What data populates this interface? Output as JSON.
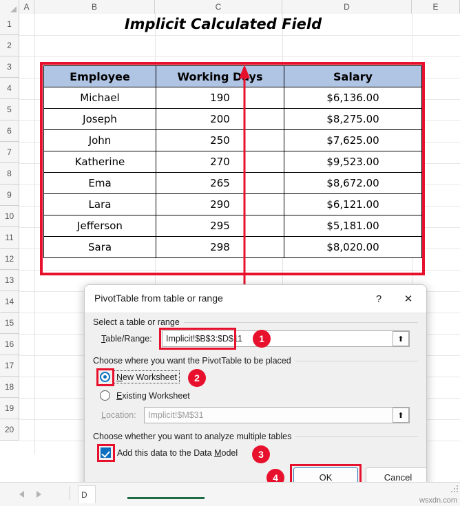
{
  "spreadsheet": {
    "column_headers": [
      "A",
      "B",
      "C",
      "D",
      "E"
    ],
    "row_headers": [
      "1",
      "2",
      "3",
      "4",
      "5",
      "6",
      "7",
      "8",
      "9",
      "10",
      "11",
      "12",
      "13",
      "14",
      "15",
      "16",
      "17",
      "18",
      "19",
      "20"
    ],
    "title": "Implicit Calculated Field",
    "header_fill": "#b0c4e4",
    "annotation_color": "#e8112d"
  },
  "table": {
    "columns": [
      "Employee",
      "Working Days",
      "Salary"
    ],
    "rows": [
      {
        "employee": "Michael",
        "working_days": "190",
        "salary": "$6,136.00"
      },
      {
        "employee": "Joseph",
        "working_days": "200",
        "salary": "$8,275.00"
      },
      {
        "employee": "John",
        "working_days": "250",
        "salary": "$7,625.00"
      },
      {
        "employee": "Katherine",
        "working_days": "270",
        "salary": "$9,523.00"
      },
      {
        "employee": "Ema",
        "working_days": "265",
        "salary": "$8,672.00"
      },
      {
        "employee": "Lara",
        "working_days": "290",
        "salary": "$6,121.00"
      },
      {
        "employee": "Jefferson",
        "working_days": "295",
        "salary": "$5,181.00"
      },
      {
        "employee": "Sara",
        "working_days": "298",
        "salary": "$8,020.00"
      }
    ]
  },
  "dialog": {
    "title": "PivotTable from table or range",
    "help_icon": "?",
    "close_icon": "✕",
    "section_source_label": "Select a table or range",
    "table_range_label": "Table/Range:",
    "table_range_value": "Implicit!$B$3:$D$11",
    "picker_icon": "⬆",
    "section_placement_label": "Choose where you want the PivotTable to be placed",
    "radio_new_worksheet": "New Worksheet",
    "radio_existing_worksheet": "Existing Worksheet",
    "selected_placement": "New Worksheet",
    "location_label": "Location:",
    "location_value": "Implicit!$M$31",
    "section_multitable_label": "Choose whether you want to analyze multiple tables",
    "checkbox_data_model": "Add this data to the Data Model",
    "checkbox_data_model_checked": true,
    "ok_label": "OK",
    "cancel_label": "Cancel"
  },
  "annotations": {
    "badges": [
      "1",
      "2",
      "3",
      "4"
    ]
  },
  "sheetbar": {
    "prev_icon": "prev-sheet-arrow",
    "next_icon": "next-sheet-arrow",
    "tab_label": "D"
  },
  "watermark": "wsxdn.com"
}
